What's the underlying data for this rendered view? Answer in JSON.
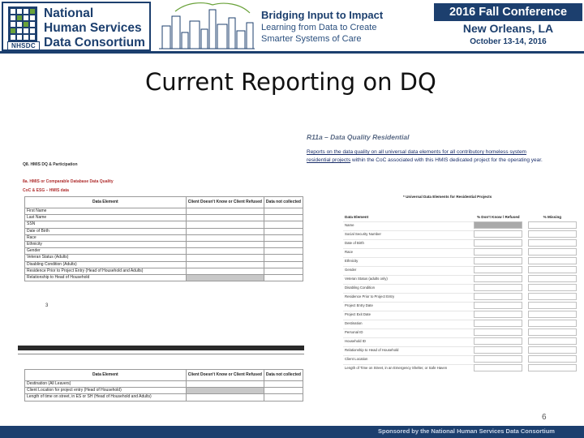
{
  "header": {
    "org_name_line1": "National",
    "org_name_line2": "Human Services",
    "org_name_line3": "Data Consortium",
    "org_abbrev": "NHSDC",
    "theme_title": "Bridging Input to Impact",
    "theme_sub1": "Learning from Data to Create",
    "theme_sub2": "Smarter Systems of Care",
    "conference_name": "2016 Fall Conference",
    "conference_city": "New Orleans, LA",
    "conference_dates": "October 13-14, 2016",
    "colors": {
      "brand_navy": "#1c3f6e",
      "accent_green": "#6aa23a"
    }
  },
  "slide": {
    "title": "Current Reporting on DQ",
    "page_number": "6"
  },
  "left_form": {
    "section_heading": "Q8. HMIS DQ & Participation",
    "subsection_heading": "8a. HMIS or Comparable Database Data Quality",
    "table_label": "CoC & ESG – HMIS data",
    "table1": {
      "headers": [
        "Data Element",
        "Client Doesn't Know or Client Refused",
        "Data not collected"
      ],
      "rows": [
        "First Name",
        "Last Name",
        "SSN",
        "Date of Birth",
        "Race",
        "Ethnicity",
        "Gender",
        "Veteran Status (Adults)",
        "Disabling Condition (Adults)",
        "Residence Prior to Project Entry (Head of Household and Adults)",
        "Relationship to Head of Household"
      ]
    },
    "page_marker": "3",
    "table2": {
      "headers": [
        "Data Element",
        "Client Doesn't Know or Client Refused",
        "Data not collected"
      ],
      "rows": [
        "Destination (All Leavers)",
        "Client Location for project entry (Head of Household)",
        "Length of time on street, in ES or SH (Head of Household and Adults)"
      ]
    }
  },
  "right_report": {
    "heading": "R11a – Data Quality Residential",
    "desc_line1_before": "Reports on the data quality on all universal data elements for all contributory homeless system",
    "desc_line2_link": "residential projects",
    "desc_line2_after": " within the CoC associated with this HMIS dedicated project for the operating year.",
    "caption": "* Universal Data Elements for Residential Projects",
    "headers": [
      "Data Element",
      "% Don't Know / Refused",
      "% Missing"
    ],
    "rows": [
      "Name",
      "Social Security Number",
      "Date of Birth",
      "Race",
      "Ethnicity",
      "Gender",
      "Veteran Status (adults only)",
      "Disabling Condition",
      "Residence Prior to Project Entry",
      "Project Entry Date",
      "Project Exit Date",
      "Destination",
      "Personal ID",
      "Household ID",
      "Relationship to Head of Household",
      "Client Location",
      "Length of Time on Street, in an Emergency Shelter, or Safe Haven"
    ]
  },
  "footer": {
    "sponsor_text": "Sponsored by the National Human Services Data Consortium"
  }
}
